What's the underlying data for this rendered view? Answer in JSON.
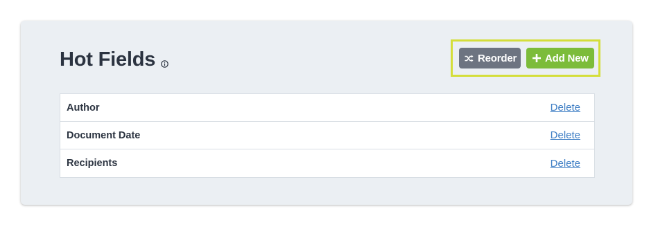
{
  "header": {
    "title": "Hot Fields",
    "info_icon": "info-circle-icon"
  },
  "toolbar": {
    "reorder_label": "Reorder",
    "reorder_icon": "shuffle-icon",
    "add_new_label": "Add New",
    "add_new_icon": "plus-icon",
    "highlight_color": "#d4de3a"
  },
  "fields": {
    "rows": [
      {
        "label": "Author",
        "action": "Delete"
      },
      {
        "label": "Document Date",
        "action": "Delete"
      },
      {
        "label": "Recipients",
        "action": "Delete"
      }
    ]
  },
  "colors": {
    "panel_bg": "#ebeff3",
    "title_text": "#2b3340",
    "reorder_button": "#6d7481",
    "add_button": "#7cbc3a",
    "link": "#3d7dc4"
  }
}
